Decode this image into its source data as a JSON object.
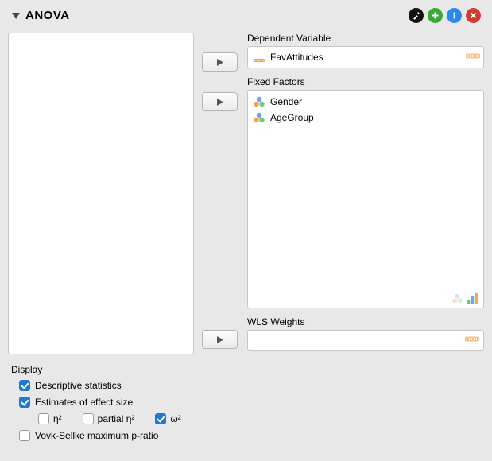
{
  "header": {
    "title": "ANOVA"
  },
  "labels": {
    "dependent": "Dependent Variable",
    "fixedFactors": "Fixed Factors",
    "wlsWeights": "WLS Weights"
  },
  "dependentVariable": {
    "name": "FavAttitudes"
  },
  "fixedFactors": [
    {
      "name": "Gender"
    },
    {
      "name": "AgeGroup"
    }
  ],
  "display": {
    "header": "Display",
    "descriptive": {
      "label": "Descriptive statistics",
      "checked": true
    },
    "effectSize": {
      "label": "Estimates of effect size",
      "checked": true
    },
    "eta2": {
      "label": "η²",
      "checked": false
    },
    "partialEta2": {
      "label": "partial η²",
      "checked": false
    },
    "omega2": {
      "label": "ω²",
      "checked": true
    },
    "vovkSellke": {
      "label": "Vovk-Sellke maximum p-ratio",
      "checked": false
    }
  }
}
